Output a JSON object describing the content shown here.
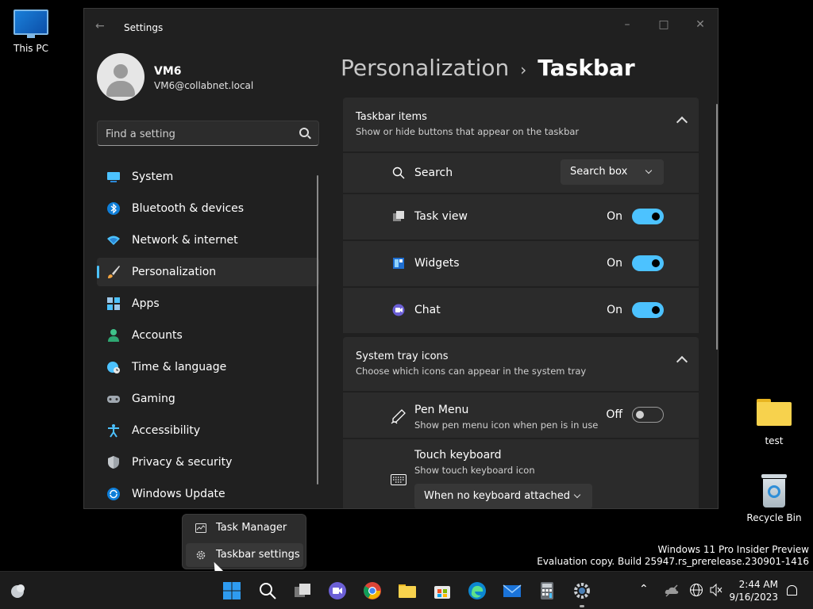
{
  "desktop": {
    "icons": [
      {
        "label": "This PC"
      },
      {
        "label": "test"
      },
      {
        "label": "Recycle Bin"
      }
    ],
    "watermark_line1": "Windows 11 Pro Insider Preview",
    "watermark_line2": "Evaluation copy. Build 25947.rs_prerelease.230901-1416"
  },
  "window": {
    "title": "Settings",
    "user": {
      "name": "VM6",
      "email": "VM6@collabnet.local"
    },
    "search_placeholder": "Find a setting",
    "nav": [
      {
        "label": "System",
        "icon": "monitor-icon"
      },
      {
        "label": "Bluetooth & devices",
        "icon": "bluetooth-icon"
      },
      {
        "label": "Network & internet",
        "icon": "wifi-icon"
      },
      {
        "label": "Personalization",
        "icon": "brush-icon",
        "active": true
      },
      {
        "label": "Apps",
        "icon": "apps-icon"
      },
      {
        "label": "Accounts",
        "icon": "person-icon"
      },
      {
        "label": "Time & language",
        "icon": "globe-clock-icon"
      },
      {
        "label": "Gaming",
        "icon": "gamepad-icon"
      },
      {
        "label": "Accessibility",
        "icon": "accessibility-icon"
      },
      {
        "label": "Privacy & security",
        "icon": "shield-icon"
      },
      {
        "label": "Windows Update",
        "icon": "update-icon"
      }
    ],
    "breadcrumb": {
      "parent": "Personalization",
      "current": "Taskbar"
    },
    "taskbar_items": {
      "title": "Taskbar items",
      "subtitle": "Show or hide buttons that appear on the taskbar",
      "search": {
        "label": "Search",
        "value": "Search box"
      },
      "task_view": {
        "label": "Task view",
        "state": "On"
      },
      "widgets": {
        "label": "Widgets",
        "state": "On"
      },
      "chat": {
        "label": "Chat",
        "state": "On"
      }
    },
    "system_tray": {
      "title": "System tray icons",
      "subtitle": "Choose which icons can appear in the system tray",
      "pen_menu": {
        "label": "Pen Menu",
        "desc": "Show pen menu icon when pen is in use",
        "state": "Off"
      },
      "touch_keyboard": {
        "label": "Touch keyboard",
        "desc": "Show touch keyboard icon",
        "value": "When no keyboard attached"
      }
    }
  },
  "context_menu": {
    "items": [
      {
        "label": "Task Manager",
        "icon": "task-manager-icon"
      },
      {
        "label": "Taskbar settings",
        "icon": "gear-icon"
      }
    ]
  },
  "taskbar": {
    "time": "2:44 AM",
    "date": "9/16/2023"
  },
  "colors": {
    "accent": "#4cc2ff",
    "surface": "#2b2b2b",
    "window_bg": "#202020"
  }
}
